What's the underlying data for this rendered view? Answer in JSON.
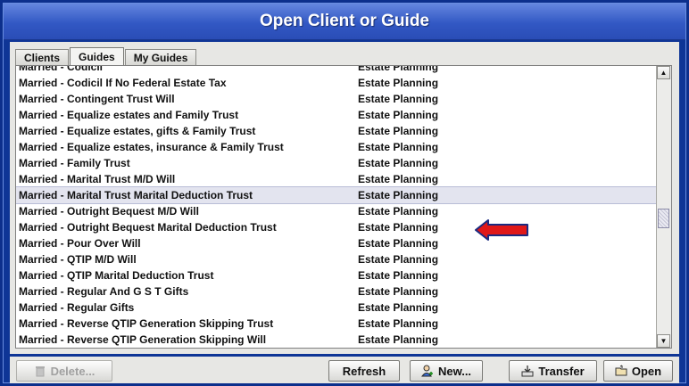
{
  "window": {
    "title": "Open Client or Guide"
  },
  "tabs": [
    {
      "label": "Clients",
      "active": false
    },
    {
      "label": "Guides",
      "active": true
    },
    {
      "label": "My Guides",
      "active": false
    }
  ],
  "list": {
    "rows": [
      {
        "name": "Married - Codicil",
        "category": "Estate Planning"
      },
      {
        "name": "Married - Codicil If No Federal Estate Tax",
        "category": "Estate Planning"
      },
      {
        "name": "Married - Contingent Trust Will",
        "category": "Estate Planning"
      },
      {
        "name": "Married - Equalize estates and Family Trust",
        "category": "Estate Planning"
      },
      {
        "name": "Married - Equalize estates, gifts & Family Trust",
        "category": "Estate Planning"
      },
      {
        "name": "Married - Equalize estates, insurance & Family Trust",
        "category": "Estate Planning"
      },
      {
        "name": "Married - Family Trust",
        "category": "Estate Planning"
      },
      {
        "name": "Married - Marital Trust M/D Will",
        "category": "Estate Planning"
      },
      {
        "name": "Married - Marital Trust Marital Deduction Trust",
        "category": "Estate Planning",
        "selected": true
      },
      {
        "name": "Married - Outright Bequest M/D Will",
        "category": "Estate Planning"
      },
      {
        "name": "Married - Outright Bequest Marital Deduction Trust",
        "category": "Estate Planning"
      },
      {
        "name": "Married - Pour Over Will",
        "category": "Estate Planning"
      },
      {
        "name": "Married - QTIP M/D Will",
        "category": "Estate Planning"
      },
      {
        "name": "Married - QTIP Marital Deduction Trust",
        "category": "Estate Planning"
      },
      {
        "name": "Married - Regular And G S T Gifts",
        "category": "Estate Planning"
      },
      {
        "name": "Married - Regular Gifts",
        "category": "Estate Planning"
      },
      {
        "name": "Married - Reverse QTIP Generation Skipping Trust",
        "category": "Estate Planning"
      },
      {
        "name": "Married - Reverse QTIP Generation Skipping Will",
        "category": "Estate Planning"
      }
    ]
  },
  "buttons": {
    "delete": "Delete...",
    "refresh": "Refresh",
    "new": "New...",
    "transfer": "Transfer",
    "open": "Open"
  },
  "colors": {
    "title_bar": "#3258c4",
    "window_bg": "#0e3596",
    "arrow": "#e01818",
    "selected_row": "#e3e4ef"
  },
  "icons": [
    "trash-icon",
    "person-icon",
    "transfer-icon",
    "open-folder-icon",
    "scroll-up-icon",
    "scroll-down-icon",
    "pointer-arrow-icon"
  ]
}
